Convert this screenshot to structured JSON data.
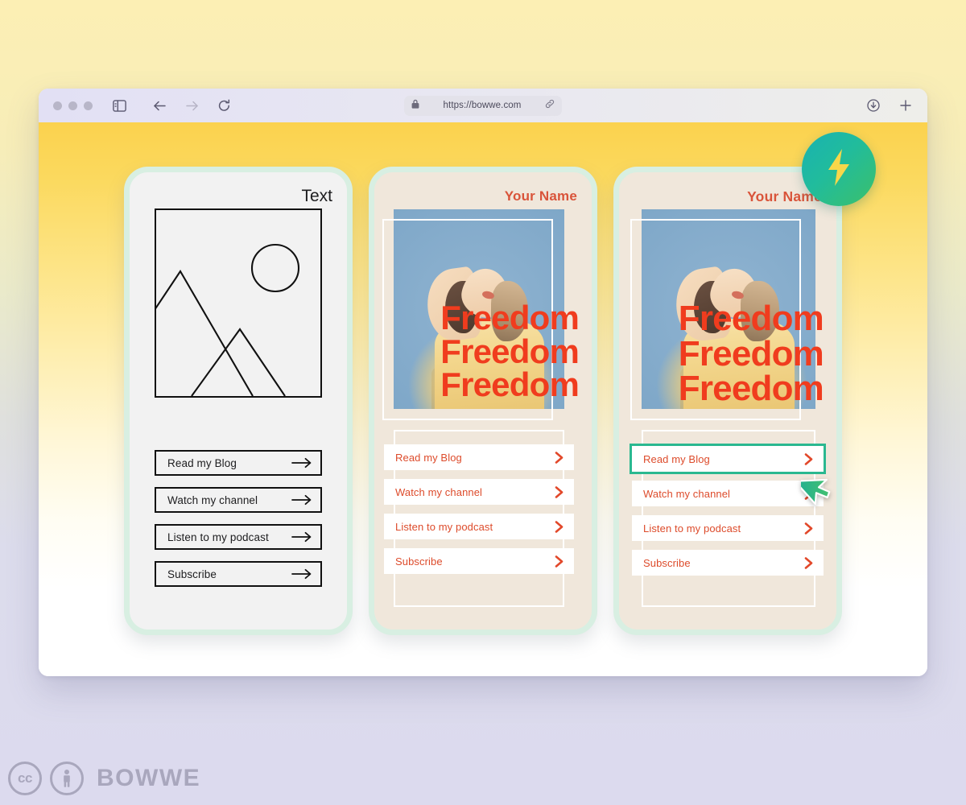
{
  "background": {
    "top_color": "#fcefb4",
    "bottom_color": "#dcdaee"
  },
  "browser": {
    "traffic_lights": [
      "dot-1",
      "dot-2",
      "dot-3"
    ],
    "sidebar_icon": "sidebar-toggle-icon",
    "back_icon": "back-arrow-icon",
    "forward_icon": "forward-arrow-icon",
    "reload_icon": "reload-icon",
    "url": "https://bowwe.com",
    "lock_icon": "lock-icon",
    "link_icon": "link-icon",
    "download_icon": "download-icon",
    "newtab_icon": "plus-icon"
  },
  "viewport": {
    "accent_red": "#f03c1e",
    "accent_teal": "#2ab890",
    "card_border": "#d8efe2"
  },
  "cards": [
    {
      "id": "wireframe",
      "title": "Text",
      "image_placeholder": "mountain-sun-placeholder",
      "buttons": [
        {
          "label": "Read my Blog",
          "icon": "arrow-right-icon"
        },
        {
          "label": "Watch my channel",
          "icon": "arrow-right-icon"
        },
        {
          "label": "Listen to my podcast",
          "icon": "arrow-right-icon"
        },
        {
          "label": "Subscribe",
          "icon": "arrow-right-icon"
        }
      ]
    },
    {
      "id": "template-preview",
      "name": "Your Name",
      "headline_lines": [
        "Freedom",
        "Freedom",
        "Freedom"
      ],
      "photo": "woman-in-yellow-shirt-blue-sky",
      "buttons": [
        {
          "label": "Read my Blog",
          "icon": "chevron-right-icon",
          "selected": false
        },
        {
          "label": "Watch my channel",
          "icon": "chevron-right-icon",
          "selected": false
        },
        {
          "label": "Listen to my podcast",
          "icon": "chevron-right-icon",
          "selected": false
        },
        {
          "label": "Subscribe",
          "icon": "chevron-right-icon",
          "selected": false
        }
      ]
    },
    {
      "id": "template-selected",
      "name": "Your Name",
      "headline_lines": [
        "Freedom",
        "Freedom",
        "Freedom"
      ],
      "photo": "woman-in-yellow-shirt-blue-sky",
      "buttons": [
        {
          "label": "Read my Blog",
          "icon": "chevron-right-icon",
          "selected": true
        },
        {
          "label": "Watch my channel",
          "icon": "chevron-right-icon",
          "selected": false
        },
        {
          "label": "Listen to my podcast",
          "icon": "chevron-right-icon",
          "selected": false
        },
        {
          "label": "Subscribe",
          "icon": "chevron-right-icon",
          "selected": false
        }
      ]
    }
  ],
  "badge": {
    "icon": "lightning-bolt-icon",
    "gradient_from": "#19b2b2",
    "gradient_to": "#3cc06a"
  },
  "cursor": {
    "icon": "mouse-pointer-icon",
    "color_from": "#2ab890",
    "color_to": "#38c06b"
  },
  "footer": {
    "cc_label": "cc",
    "by_icon": "person-icon",
    "brand": "BOWWE"
  }
}
